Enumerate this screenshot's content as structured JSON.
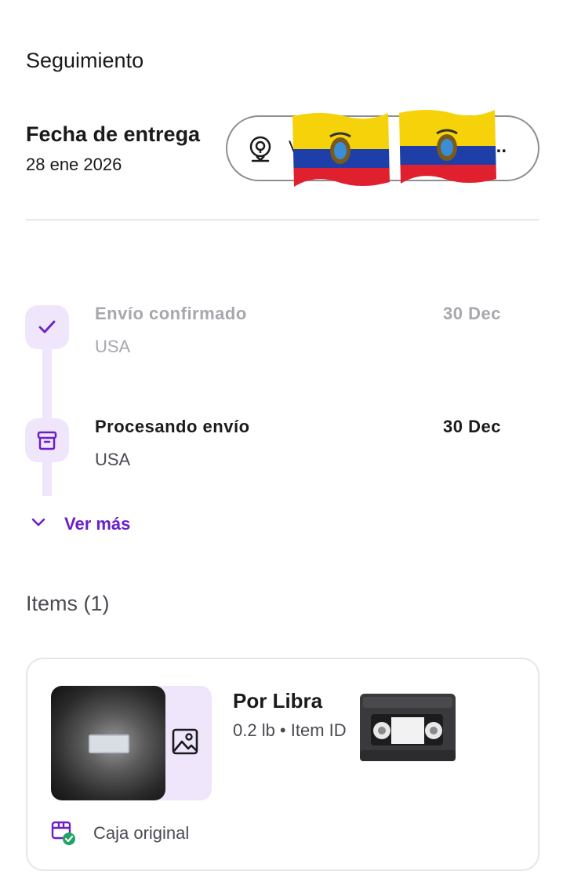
{
  "header": {
    "title": "Seguimiento"
  },
  "delivery": {
    "label": "Fecha de entrega",
    "date": "28 ene 2026",
    "address_text": "V",
    "address_ellipsis": "..."
  },
  "timeline": {
    "steps": [
      {
        "title": "Envío confirmado",
        "location": "USA",
        "date": "30 Dec",
        "state": "completed"
      },
      {
        "title": "Procesando envío",
        "location": "USA",
        "date": "30 Dec",
        "state": "current"
      }
    ],
    "more_label": "Ver más"
  },
  "items": {
    "title": "Items (1)",
    "list": [
      {
        "name": "Por Libra",
        "meta": "0.2 lb • Item ID",
        "badge": "Caja original"
      }
    ]
  },
  "colors": {
    "accent": "#6a1fc7",
    "accent_light": "#efe6fc",
    "muted_text": "#a7a7ad",
    "success": "#1fa463"
  }
}
